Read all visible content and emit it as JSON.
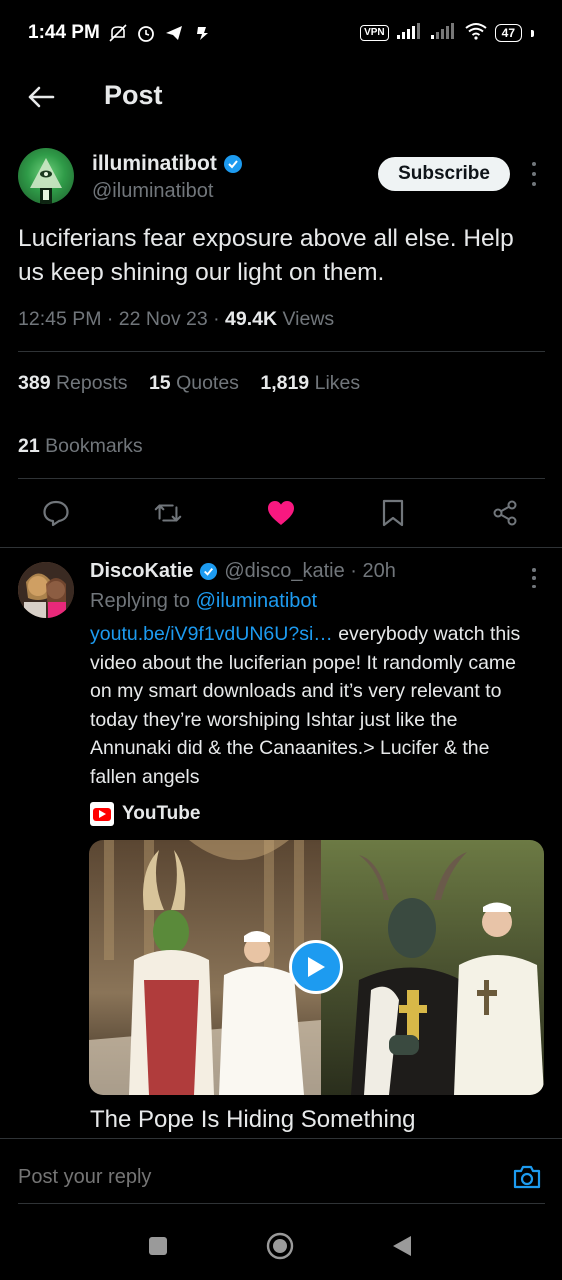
{
  "status_bar": {
    "time": "1:44 PM",
    "vpn": "VPN",
    "battery": "47",
    "icons": [
      "mute-icon",
      "alarm-icon",
      "telegram-icon",
      "notification-icon",
      "signal-icon",
      "signal-icon",
      "wifi-icon",
      "battery-icon"
    ]
  },
  "header": {
    "title": "Post"
  },
  "post": {
    "author_name": "illuminatibot",
    "author_handle": "@iluminatibot",
    "subscribe_label": "Subscribe",
    "text": "Luciferians fear exposure above all else. Help us keep shining our light on them.",
    "timestamp": "12:45 PM · 22 Nov 23 · ",
    "views_count": "49.4K",
    "views_label": " Views",
    "stats": {
      "reposts_count": "389",
      "reposts_label": "Reposts",
      "quotes_count": "15",
      "quotes_label": "Quotes",
      "likes_count": "1,819",
      "likes_label": "Likes",
      "bookmarks_count": "21",
      "bookmarks_label": "Bookmarks"
    },
    "liked": true,
    "accent_like": "#f91880",
    "accent_link": "#1d9bf0"
  },
  "reply": {
    "name": "DiscoKatie",
    "handle_time": "@disco_katie · 20h",
    "replying_prefix": "Replying to ",
    "replying_to": "@iluminatibot",
    "link": "youtu.be/iV9f1vdUN6U?si…",
    "body": " everybody watch this video about the luciferian pope! It randomly came on my smart downloads and it’s very relevant to today they’re worshiping Ishtar just like the Annunaki did & the Canaanites.> Lucifer & the fallen angels",
    "source": "YouTube",
    "video_title": "The Pope Is Hiding Something"
  },
  "composer": {
    "placeholder": "Post your reply"
  }
}
